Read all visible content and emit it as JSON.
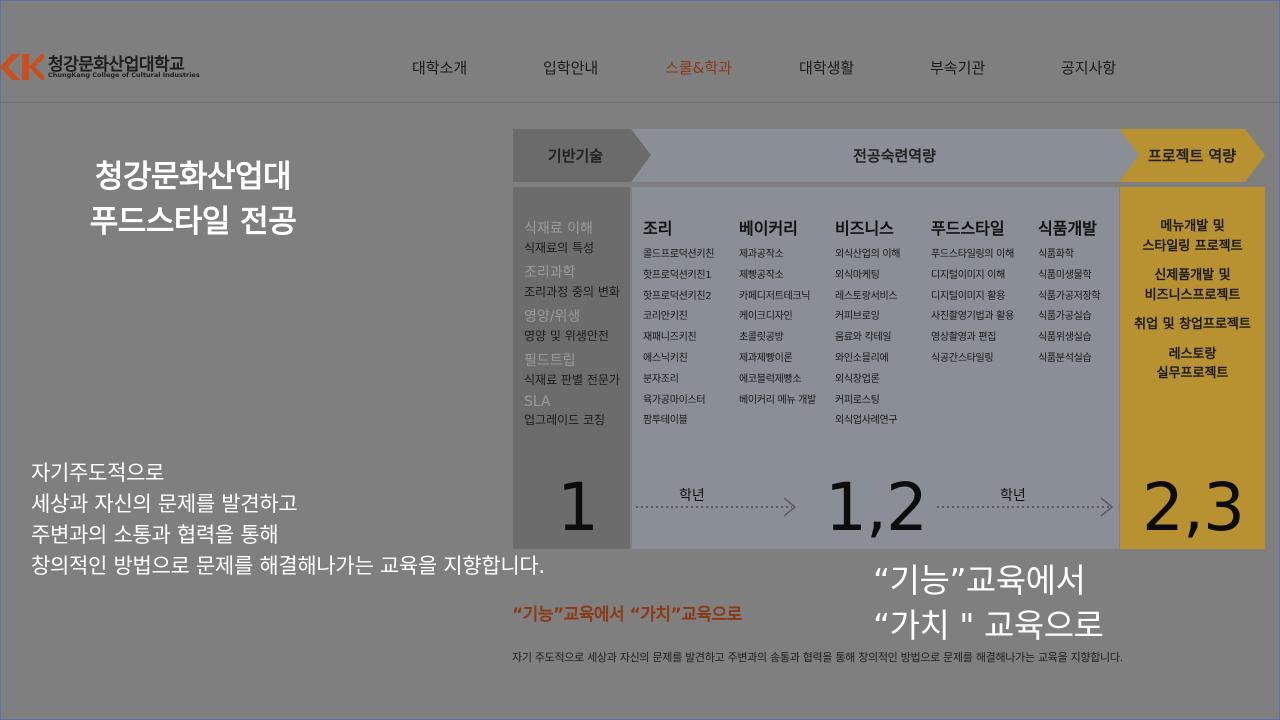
{
  "header": {
    "logo": {
      "korean": "청강문화산업대학교",
      "english": "ChungKang College of Cultural Industries",
      "brand_color": "#c8501e"
    },
    "nav": [
      {
        "label": "대학소개"
      },
      {
        "label": "입학안내"
      },
      {
        "label": "스쿨&학과",
        "active": true
      },
      {
        "label": "대학생활"
      },
      {
        "label": "부속기관"
      },
      {
        "label": "공지사항"
      }
    ],
    "active_color": "#8a3a16"
  },
  "intro": {
    "title_line1": "청강문화산업대",
    "title_line2": "푸드스타일 전공",
    "slogan": [
      "자기주도적으로",
      "세상과 자신의 문제를 발견하고",
      "주변과의 소통과 협력을 통해",
      "창의적인 방법으로 문제를 해결해나가는 교육을 지향합니다."
    ]
  },
  "curriculum": {
    "stages": [
      "기반기술",
      "전공숙련역량",
      "프로젝트 역량"
    ],
    "basic": [
      {
        "heading": "식재료 이해",
        "sub": "식재료의 특성"
      },
      {
        "heading": "조리과학",
        "sub": "조리과정 중의 변화"
      },
      {
        "heading": "영양/위생",
        "sub": "영양 및 위생안전"
      },
      {
        "heading": "필드트립",
        "sub": "식재료 판별 전문가"
      },
      {
        "heading": "SLA",
        "sub": "업그레이드 코칭"
      }
    ],
    "subjects": [
      {
        "heading": "조리",
        "items": [
          "콜드프로덕션키친",
          "핫프로덕션키친1",
          "핫프로덕션키친2",
          "코리안키친",
          "재패니즈키친",
          "에스닉키친",
          "분자조리",
          "육가공마이스터",
          "팜투테이블"
        ]
      },
      {
        "heading": "베이커리",
        "items": [
          "제과공작소",
          "제빵공작소",
          "카페디저트테크닉",
          "케이크디자인",
          "초콜릿공방",
          "제과제빵이론",
          "에코블럭제빵소",
          "베이커리 메뉴 개발"
        ]
      },
      {
        "heading": "비즈니스",
        "items": [
          "외식산업의 이해",
          "외식마케팅",
          "레스토랑서비스",
          "커피브로잉",
          "음료와 칵테일",
          "와인소믈리에",
          "외식창업론",
          "커피로스팅",
          "외식업사례연구"
        ]
      },
      {
        "heading": "푸드스타일",
        "items": [
          "푸드스타일링의 이해",
          "디지털이미지 이해",
          "디지털이미지 활용",
          "사진촬영기법과 활용",
          "영상촬영과 편집",
          "식공간스타일링"
        ]
      },
      {
        "heading": "식품개발",
        "items": [
          "식품화학",
          "식품미생물학",
          "식품가공저장학",
          "식품가공실습",
          "식품위생실습",
          "식품분석실습"
        ]
      }
    ],
    "projects": [
      [
        "메뉴개발 및",
        "스타일링 프로젝트"
      ],
      [
        "신제품개발 및",
        "비즈니스프로젝트"
      ],
      [
        "취업 및 창업프로젝트"
      ],
      [
        "레스토랑",
        "실무프로젝트"
      ]
    ],
    "years": [
      "1",
      "1,2",
      "2,3"
    ],
    "year_label": "학년",
    "colors": {
      "basic": "#6c6c6c",
      "major": "#8a8f97",
      "project": "#b89131"
    }
  },
  "quote_big": [
    "“기능”교육에서",
    "“가치 \" 교육으로"
  ],
  "quote_small": "“기능”교육에서 “가치”교육으로",
  "bottom_line": "자기 주도적으로 세상과 자신의 문제를 발견하고 주변과의 송통과 협력을 통해 창의적인 방법으로 문제를 해결해나가는 교육을 지향합니다."
}
